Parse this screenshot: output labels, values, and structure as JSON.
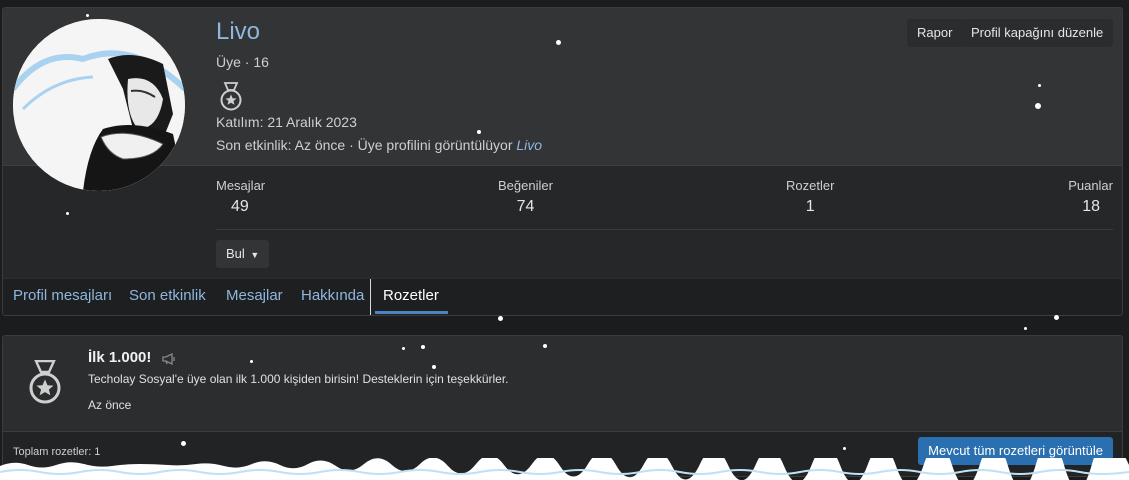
{
  "profile": {
    "name": "Livo",
    "role": "Üye · 16",
    "joined": "Katılım: 21 Aralık 2023",
    "activity_prefix": "Son etkinlik: Az önce · Üye profilini görüntülüyor",
    "activity_user": "Livo",
    "avatar_icon": "avatar-anime-character",
    "medal_icon": "medal-star-icon"
  },
  "actions": {
    "report": "Rapor",
    "edit_cover": "Profil kapağını düzenle",
    "find": "Bul"
  },
  "stats": [
    {
      "label": "Mesajlar",
      "value": "49"
    },
    {
      "label": "Beğeniler",
      "value": "74"
    },
    {
      "label": "Rozetler",
      "value": "1"
    },
    {
      "label": "Puanlar",
      "value": "18"
    }
  ],
  "tabs": [
    {
      "label": "Profil mesajları"
    },
    {
      "label": "Son etkinlik"
    },
    {
      "label": "Mesajlar"
    },
    {
      "label": "Hakkında"
    },
    {
      "label": "Rozetler",
      "active": true
    }
  ],
  "badge": {
    "title": "İlk 1.000!",
    "description": "Techolay Sosyal'e üye olan ilk 1.000 kişiden birisin! Desteklerin için teşekkürler.",
    "time": "Az önce",
    "icon": "medal-star-icon"
  },
  "footer": {
    "total": "Toplam rozetler: 1",
    "view_all": "Mevcut tüm rozetleri görüntüle"
  },
  "colors": {
    "link": "#8fb6dd",
    "accent": "#4c84c2",
    "primary_button": "#2a6fb0"
  }
}
